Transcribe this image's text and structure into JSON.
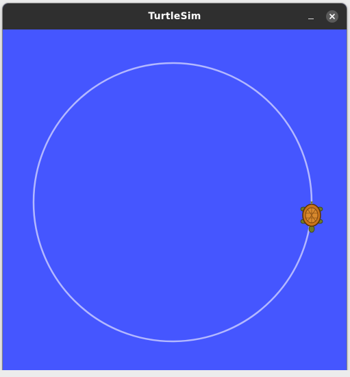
{
  "window": {
    "title": "TurtleSim",
    "buttons": {
      "minimize_icon": "minimize-icon",
      "close_icon": "close-icon"
    }
  },
  "canvas": {
    "background_color": "#4556ff",
    "pen_color": "#b3b8ff",
    "turtle_icon": "turtle-icon"
  },
  "titlebar": {
    "background_color": "#2f2f2f"
  }
}
